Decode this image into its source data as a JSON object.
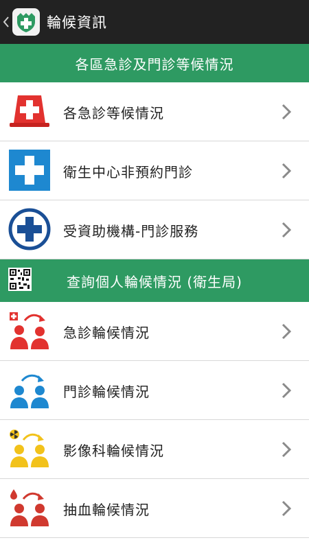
{
  "app": {
    "title": "輪候資訊"
  },
  "sections": [
    {
      "header": "各區急診及門診等候情況",
      "items": [
        {
          "label": "各急診等候情況",
          "icon": "red-cross-cone-icon",
          "color": "#e2322f"
        },
        {
          "label": "衛生中心非預約門診",
          "icon": "blue-cross-square-icon",
          "color": "#1e88d0"
        },
        {
          "label": "受資助機構-門診服務",
          "icon": "navy-cross-circle-icon",
          "color": "#1a4f96"
        }
      ]
    },
    {
      "header": "查詢個人輪候情況 (衛生局)",
      "header_icon": "qr-code-icon",
      "items": [
        {
          "label": "急診輪候情況",
          "icon": "emergency-queue-icon",
          "color": "#e2322f"
        },
        {
          "label": "門診輪候情況",
          "icon": "outpatient-queue-icon",
          "color": "#1e88d0"
        },
        {
          "label": "影像科輪候情況",
          "icon": "radiology-queue-icon",
          "color": "#f2c21b"
        },
        {
          "label": "抽血輪候情況",
          "icon": "blood-test-queue-icon",
          "color": "#d0392f"
        }
      ]
    }
  ],
  "colors": {
    "topbar": "#222222",
    "header": "#2e9a62",
    "divider": "#d7d7d7",
    "chevron": "#8a8a8a"
  }
}
